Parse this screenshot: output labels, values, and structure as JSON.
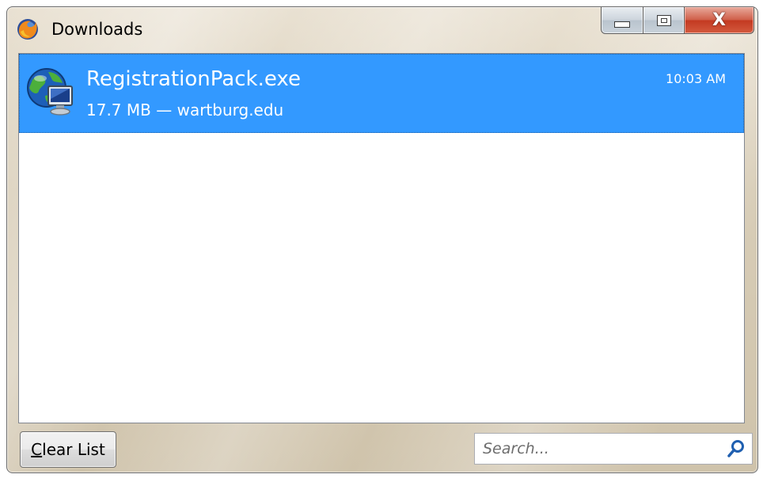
{
  "window": {
    "title": "Downloads"
  },
  "colors": {
    "selection": "#3399ff",
    "close_button": "#c43a22"
  },
  "downloads": [
    {
      "filename": "RegistrationPack.exe",
      "details": "17.7 MB — wartburg.edu",
      "time": "10:03 AM",
      "icon": "network-globe-icon"
    }
  ],
  "footer": {
    "clear_label_accel": "C",
    "clear_label_rest": "lear List",
    "search_placeholder": "Search..."
  },
  "icons": {
    "app": "firefox-icon",
    "minimize": "minimize-icon",
    "maximize": "maximize-icon",
    "close": "close-icon",
    "search": "search-icon"
  }
}
